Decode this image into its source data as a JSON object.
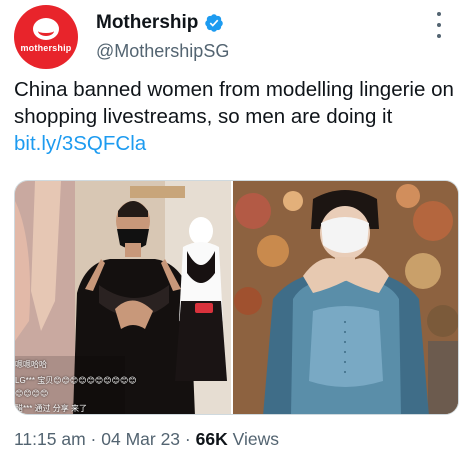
{
  "tweet": {
    "avatar_text": "mothership",
    "display_name": "Mothership",
    "handle": "@MothershipSG",
    "text": "China banned women from modelling lingerie on shopping livestreams, so men are doing it ",
    "link": "bit.ly/3SQFCla",
    "time": "11:15 am",
    "separator": "·",
    "date": "04 Mar 23",
    "views_count": "66K",
    "views_label": "Views"
  },
  "media": {
    "left_overlay": {
      "lines": [
        "嗯嗯哈哈",
        "LG*** 宝贝😊😊😊😊😊😊😊😊😊😊",
        "😊😊😊😊",
        "醋*** 通过 分享 来了"
      ]
    }
  },
  "icons": {
    "verified": "verified-badge-icon",
    "more": "more-options-icon"
  },
  "colors": {
    "brand_red": "#e8242b",
    "link_blue": "#1d9bf0",
    "verified_blue": "#1d9bf0",
    "secondary_text": "#536471"
  }
}
